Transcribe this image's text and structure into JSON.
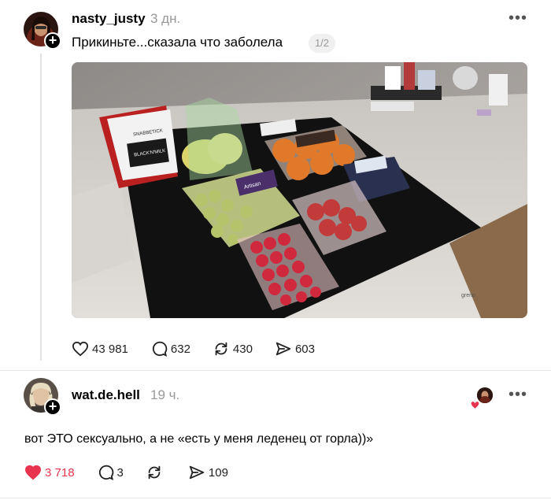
{
  "post": {
    "username": "nasty_justy",
    "time": "3 дн.",
    "text": "Прикиньте...сказала что заболела",
    "image_counter": "1/2",
    "more_label": "•••",
    "stats": {
      "likes": "43 981",
      "comments": "632",
      "reposts": "430",
      "shares": "603"
    }
  },
  "reply": {
    "username": "wat.de.hell",
    "time": "19 ч.",
    "text": "вот ЭТО сексуально, а не «есть у меня леденец от горла))»",
    "more_label": "•••",
    "stats": {
      "likes": "3 718",
      "comments": "3",
      "reposts": "",
      "shares": "109"
    }
  },
  "photo_labels": {
    "snack_bag_brand": "SNABBETICK",
    "snack_bag_label": "BLACK'N'MILK",
    "grape_box_label": "Artisan",
    "stove_brand": "greno"
  },
  "colors": {
    "like_active": "#e8344e",
    "muted_text": "#999999",
    "thread_line": "#e2e2e2"
  },
  "icons": {
    "like": "heart-icon",
    "comment": "speech-bubble-icon",
    "repost": "repost-arrows-icon",
    "share": "send-arrow-icon",
    "more": "ellipsis-icon",
    "follow": "plus-badge-icon"
  }
}
